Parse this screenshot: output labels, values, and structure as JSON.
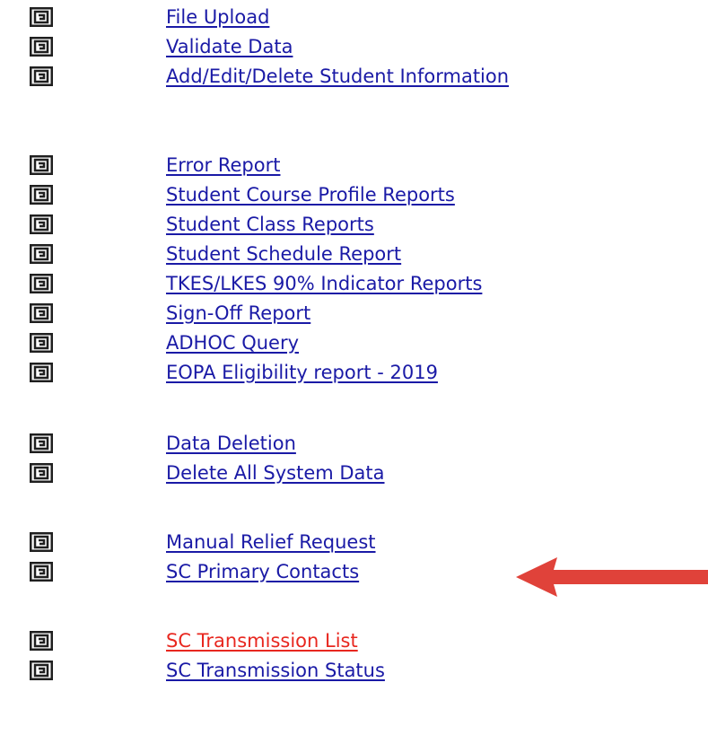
{
  "colors": {
    "link": "#1a1aa6",
    "link_highlight": "#e8271f",
    "arrow": "#e0423a",
    "icon": "#1f1f1f"
  },
  "icon_name": "spiral-menu-icon",
  "groups": [
    {
      "items": [
        {
          "label": "File Upload"
        },
        {
          "label": "Validate Data"
        },
        {
          "label": "Add/Edit/Delete Student Information"
        }
      ]
    },
    {
      "items": [
        {
          "label": "Error Report"
        },
        {
          "label": "Student Course Profile Reports"
        },
        {
          "label": "Student Class Reports"
        },
        {
          "label": "Student Schedule Report"
        },
        {
          "label": "TKES/LKES 90% Indicator Reports"
        },
        {
          "label": "Sign-Off Report"
        },
        {
          "label": "ADHOC Query"
        },
        {
          "label": "EOPA Eligibility report - 2019"
        }
      ]
    },
    {
      "items": [
        {
          "label": "Data Deletion"
        },
        {
          "label": "Delete All System Data"
        }
      ]
    },
    {
      "items": [
        {
          "label": "Manual Relief Request"
        },
        {
          "label": "SC Primary Contacts"
        }
      ]
    },
    {
      "items": [
        {
          "label": "SC Transmission List",
          "highlight": true
        },
        {
          "label": "SC Transmission Status"
        }
      ]
    }
  ]
}
